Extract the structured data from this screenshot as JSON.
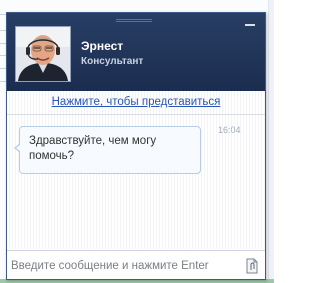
{
  "chat": {
    "agent": {
      "name": "Эрнест",
      "role": "Консультант",
      "avatar_icon": "agent-avatar-photo"
    },
    "intro_link": "Нажмите, чтобы представиться",
    "messages": [
      {
        "text": "Здравствуйте, чем могу помочь?",
        "time": "16:04"
      }
    ],
    "input": {
      "placeholder": "Введите сообщение и нажмите Enter",
      "value": ""
    },
    "icons": {
      "minimize": "minimize-icon",
      "attach": "attach-file-icon"
    },
    "colors": {
      "header": "#1e3153",
      "link": "#2a55b5",
      "bubble_border": "#b7cde6"
    }
  }
}
